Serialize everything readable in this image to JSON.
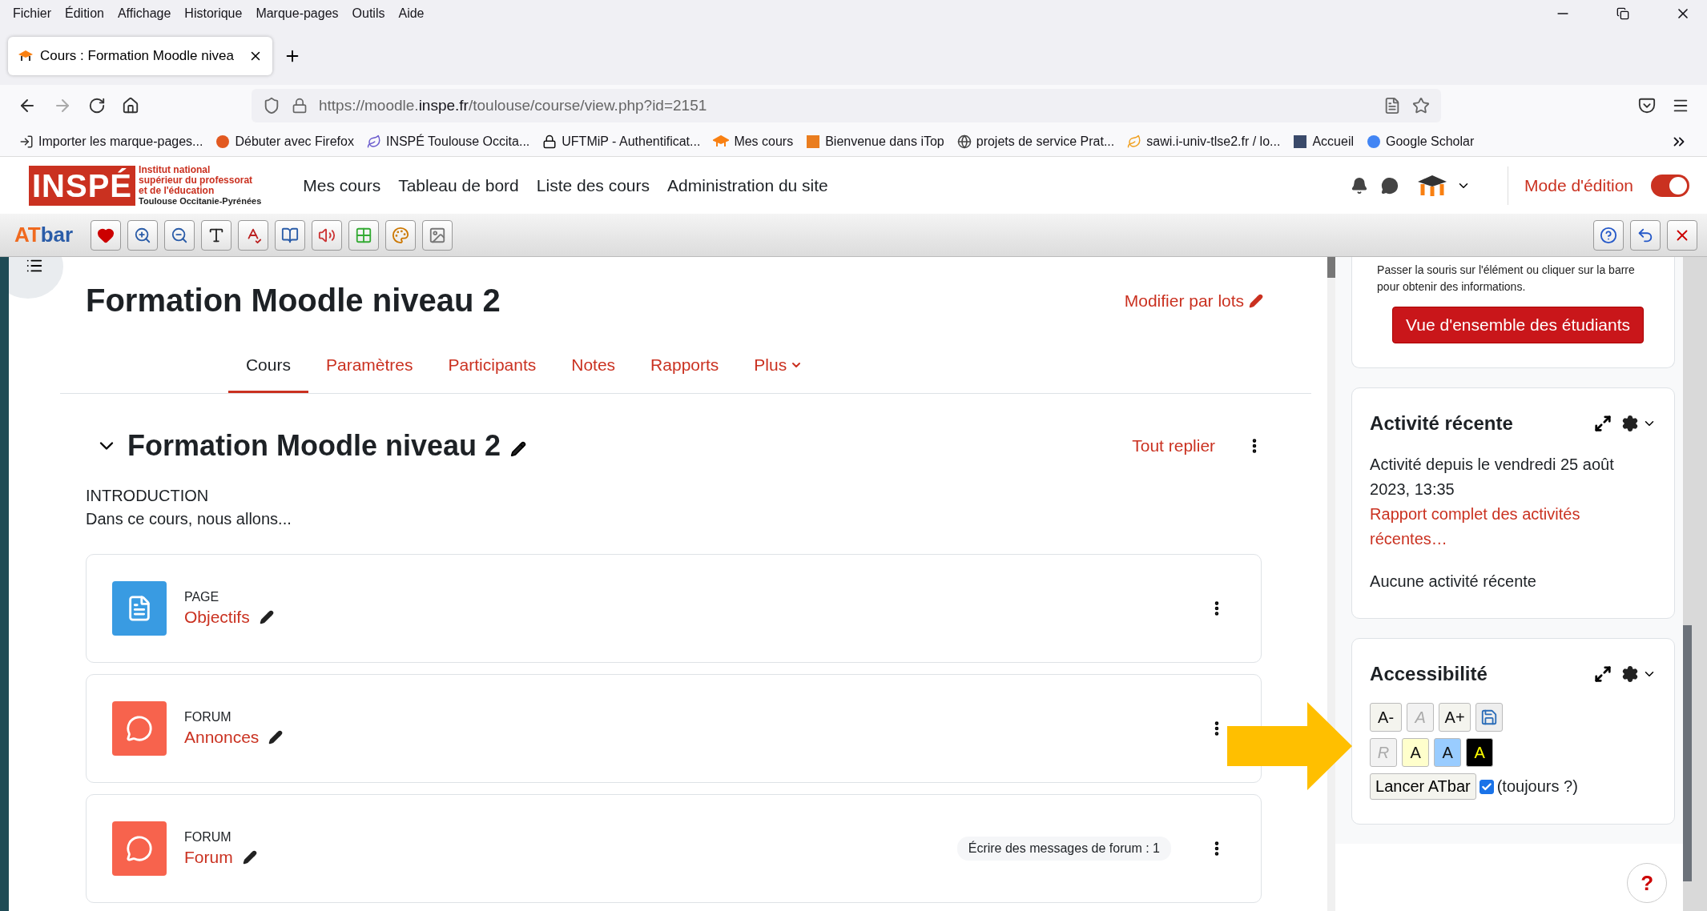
{
  "menu_bar": [
    "Fichier",
    "Édition",
    "Affichage",
    "Historique",
    "Marque-pages",
    "Outils",
    "Aide"
  ],
  "browser_tab": {
    "title": "Cours : Formation Moodle nivea",
    "selected": true
  },
  "address": {
    "prefix": "https://moodle.",
    "domain": "inspe.fr",
    "path": "/toulouse/course/view.php?id=2151"
  },
  "bookmarks": [
    {
      "label": "Importer les marque-pages...",
      "kind": "import",
      "color": "#333333"
    },
    {
      "label": "Débuter avec Firefox",
      "kind": "circle",
      "color": "#e25920"
    },
    {
      "label": "INSPÉ Toulouse Occita...",
      "kind": "leaf",
      "color": "#6a5acd"
    },
    {
      "label": "UFTMiP - Authentificat...",
      "kind": "lock",
      "color": "#111111"
    },
    {
      "label": "Mes cours",
      "kind": "moodle",
      "color": "#f98012"
    },
    {
      "label": "Bienvenue dans iTop",
      "kind": "square",
      "color": "#ea7d1f"
    },
    {
      "label": "projets de service Prat...",
      "kind": "globe",
      "color": "#444444"
    },
    {
      "label": "sawi.i-univ-tlse2.fr / lo...",
      "kind": "leaf",
      "color": "#f0a020"
    },
    {
      "label": "Accueil",
      "kind": "square",
      "color": "#3a4a6a"
    },
    {
      "label": "Google Scholar",
      "kind": "circle",
      "color": "#4285f4"
    }
  ],
  "site_header": {
    "logo": {
      "mark": "INSPÉ",
      "lines": [
        "Institut national",
        "supérieur du professorat",
        "et de l'éducation"
      ],
      "region": "Toulouse Occitanie-Pyrénées"
    },
    "nav": [
      "Mes cours",
      "Tableau de bord",
      "Liste des cours",
      "Administration du site"
    ],
    "edit_mode": {
      "label": "Mode d'édition",
      "on": true
    }
  },
  "atbar": {
    "logo_a": "AT",
    "logo_b": "bar",
    "tools": [
      {
        "kind": "heart"
      },
      {
        "kind": "zoom-in"
      },
      {
        "kind": "zoom-out"
      },
      {
        "kind": "font"
      },
      {
        "kind": "spell"
      },
      {
        "kind": "book"
      },
      {
        "kind": "sound"
      },
      {
        "kind": "grid"
      },
      {
        "kind": "palette"
      },
      {
        "kind": "image"
      }
    ],
    "right_tools": [
      {
        "kind": "help"
      },
      {
        "kind": "undo"
      },
      {
        "kind": "close"
      }
    ]
  },
  "course": {
    "title": "Formation Moodle niveau 2",
    "bulk_edit": "Modifier par lots",
    "tabs": [
      {
        "label": "Cours",
        "selected": true,
        "kind": "link"
      },
      {
        "label": "Paramètres",
        "selected": false,
        "kind": "link"
      },
      {
        "label": "Participants",
        "selected": false,
        "kind": "link"
      },
      {
        "label": "Notes",
        "selected": false,
        "kind": "link"
      },
      {
        "label": "Rapports",
        "selected": false,
        "kind": "link"
      },
      {
        "label": "Plus",
        "selected": false,
        "kind": "menu"
      }
    ]
  },
  "section": {
    "title": "Formation Moodle niveau 2",
    "expanded": true,
    "collapse_all": "Tout replier",
    "summary_title": "INTRODUCTION",
    "summary_text": "Dans ce cours, nous allons...",
    "activities": [
      {
        "kind": "page",
        "type_label": "PAGE",
        "name": "Objectifs"
      },
      {
        "kind": "forum",
        "type_label": "FORUM",
        "name": "Annonces"
      },
      {
        "kind": "forum",
        "type_label": "FORUM",
        "name": "Forum",
        "badge": "Écrire des messages de forum : 1"
      }
    ]
  },
  "sidebar": {
    "overview": {
      "hint": "Passer la souris sur l'élément ou cliquer sur la barre pour obtenir des informations.",
      "button": "Vue d'ensemble des étudiants"
    },
    "recent": {
      "title": "Activité récente",
      "since": "Activité depuis le vendredi 25 août 2023, 13:35",
      "report_link": "Rapport complet des activités récentes…",
      "empty": "Aucune activité récente"
    },
    "accessibility": {
      "title": "Accessibilité",
      "rows": [
        [
          {
            "kind": "text",
            "label": "A-",
            "disabled": false
          },
          {
            "kind": "text",
            "label": "A",
            "disabled": true
          },
          {
            "kind": "text",
            "label": "A+",
            "disabled": false
          },
          {
            "kind": "save",
            "disabled": false
          }
        ],
        [
          {
            "kind": "text",
            "label": "R",
            "disabled": true
          },
          {
            "kind": "color",
            "label": "A",
            "color": "#ffffcc",
            "disabled": false
          },
          {
            "kind": "color",
            "label": "A",
            "color": "#99ccff",
            "disabled": false
          },
          {
            "kind": "color",
            "label": "A",
            "color": "#000000",
            "disabled": false
          }
        ]
      ],
      "launch": "Lancer ATbar",
      "always": {
        "label": "(toujours ?)",
        "checked": true
      }
    },
    "help": "?"
  }
}
